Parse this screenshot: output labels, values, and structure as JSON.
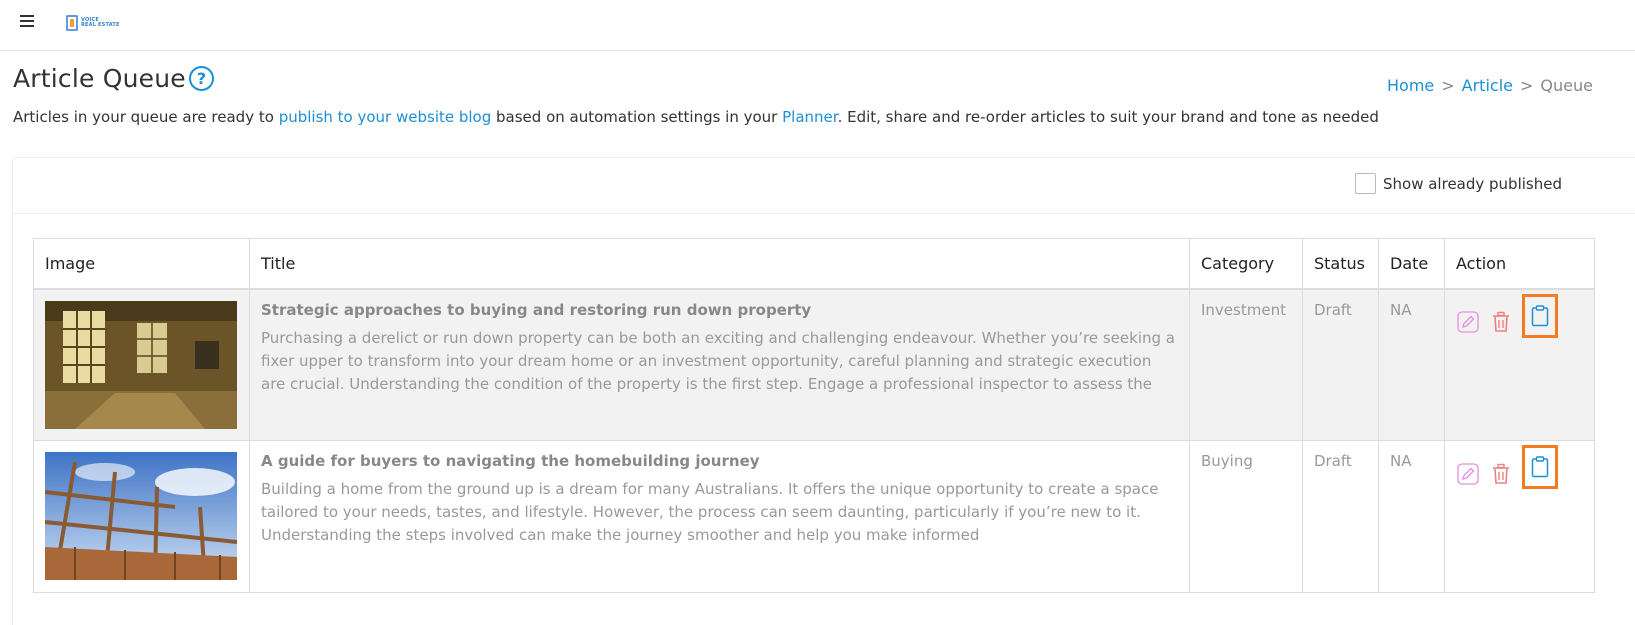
{
  "app": {
    "logo_text_line1": "VOICE",
    "logo_text_line2": "REAL ESTATE"
  },
  "header": {
    "title": "Article Queue",
    "help_glyph": "?"
  },
  "breadcrumb": {
    "home": "Home",
    "article": "Article",
    "current": "Queue",
    "separator": ">"
  },
  "intro": {
    "text_before": "Articles in your queue are ready to ",
    "link1": "publish to your website blog",
    "text_middle": " based on automation settings in your ",
    "link2": "Planner",
    "text_after": ". Edit, share and re-order articles to suit your brand and tone as needed"
  },
  "filters": {
    "show_published_label": "Show already published",
    "show_published_checked": false
  },
  "table": {
    "columns": [
      "Image",
      "Title",
      "Category",
      "Status",
      "Date",
      "Action"
    ],
    "rows": [
      {
        "image_icon": "abandoned-room-photo",
        "title": "Strategic approaches to buying and restoring run down property",
        "excerpt": "Purchasing a derelict or run down property can be both an exciting and challenging endeavour. Whether you’re seeking a fixer upper to transform into your dream home or an investment opportunity, careful planning and strategic execution are crucial. Understanding the condition of the property is the first step.  Engage a professional inspector to assess the",
        "category": "Investment",
        "status": "Draft",
        "date": "NA"
      },
      {
        "image_icon": "house-frame-photo",
        "title": "A guide for buyers to navigating the homebuilding journey",
        "excerpt": "Building a home from the ground up is a dream for many Australians. It offers the unique opportunity to create a space tailored to your needs, tastes, and lifestyle. However, the process can seem daunting, particularly if you’re new to it. Understanding the steps involved can make the journey smoother and help you make informed",
        "category": "Buying",
        "status": "Draft",
        "date": "NA"
      }
    ]
  },
  "icons": {
    "edit": "edit-icon",
    "delete": "delete-icon",
    "copy": "clipboard-icon"
  },
  "colors": {
    "accent": "#1d8fd6",
    "edit_icon": "#e58ee0",
    "delete_icon": "#f08080",
    "highlight_box": "#f47c20"
  }
}
